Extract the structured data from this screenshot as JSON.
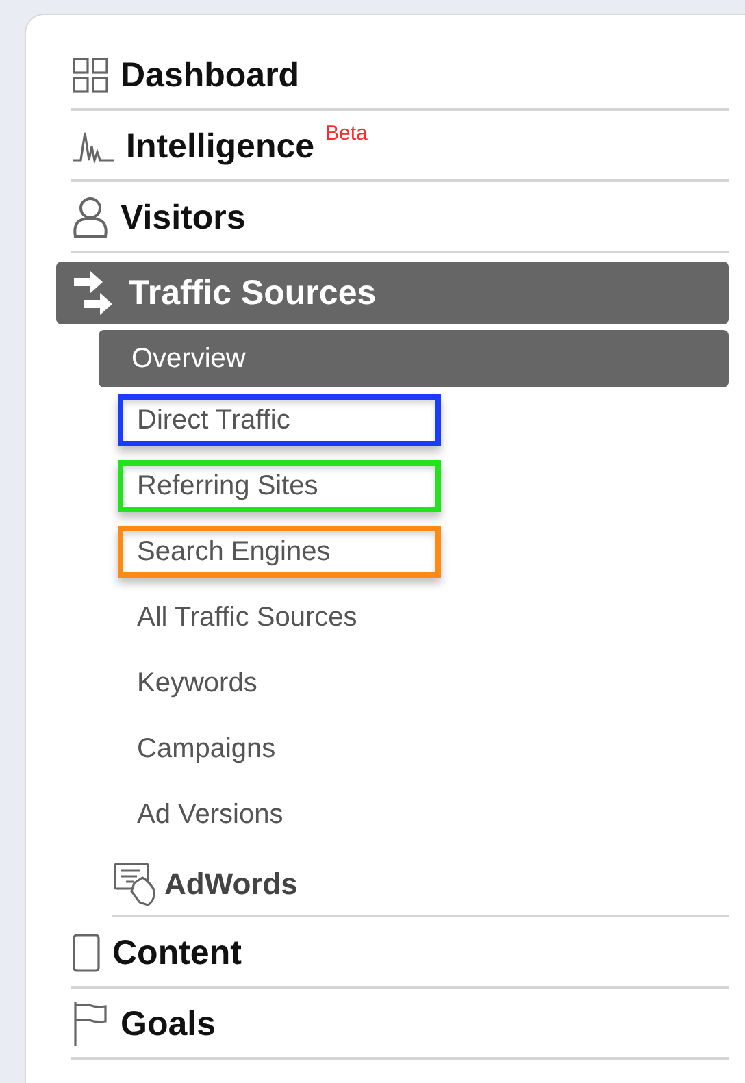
{
  "sections": [
    {
      "label": "Dashboard",
      "selected": false
    },
    {
      "label": "Intelligence",
      "badge": "Beta",
      "selected": false
    },
    {
      "label": "Visitors",
      "selected": false
    },
    {
      "label": "Traffic Sources",
      "selected": true,
      "children": [
        {
          "kind": "link",
          "label": "Overview",
          "selected": true
        },
        {
          "kind": "link",
          "label": "Direct Traffic",
          "selected": false,
          "color": "#1a3cff"
        },
        {
          "kind": "link",
          "label": "Referring Sites",
          "selected": false,
          "color": "#22e31e"
        },
        {
          "kind": "link",
          "label": "Search Engines",
          "selected": false,
          "color": "#ff8a12"
        },
        {
          "kind": "link",
          "label": "All Traffic Sources",
          "selected": false
        },
        {
          "kind": "link",
          "label": "Keywords",
          "selected": false
        },
        {
          "kind": "link",
          "label": "Campaigns",
          "selected": false
        },
        {
          "kind": "link",
          "label": "Ad Versions",
          "selected": false
        },
        {
          "kind": "group",
          "label": "AdWords"
        }
      ]
    },
    {
      "label": "Content",
      "selected": false
    },
    {
      "label": "Goals",
      "selected": false
    }
  ]
}
